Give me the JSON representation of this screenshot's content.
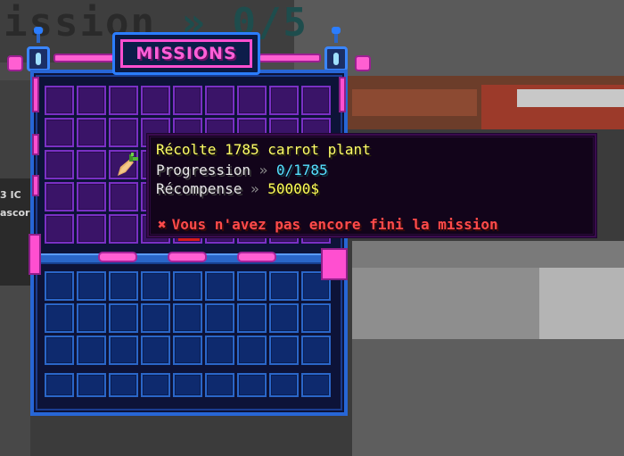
{
  "background": {
    "hud_text": "ission",
    "hud_counter": "0/5",
    "hud_separator": "»",
    "side_labels": [
      "3 IC",
      "ascori"
    ]
  },
  "panel": {
    "title": "MISSIONS",
    "top_rows": 5,
    "bottom_rows": 4,
    "columns": 9,
    "item": {
      "icon": "carrot-icon",
      "name": "carrot"
    }
  },
  "tooltip": {
    "title": "Récolte 1785 carrot plant",
    "progress_label": "Progression",
    "progress_sep": "»",
    "progress_value": "0/1785",
    "reward_label": "Récompense",
    "reward_sep": "»",
    "reward_value": "50000$",
    "status_icon": "cross-icon",
    "status_text": "Vous n'avez pas encore fini la mission"
  },
  "colors": {
    "title": "#ff5fd8",
    "tooltip_title": "#ffff66",
    "progress": "#55e0ff",
    "reward": "#ffff55",
    "warning": "#ff4a4a",
    "top_slots": "#3a1468",
    "bottom_slots": "#0e2a6e"
  }
}
